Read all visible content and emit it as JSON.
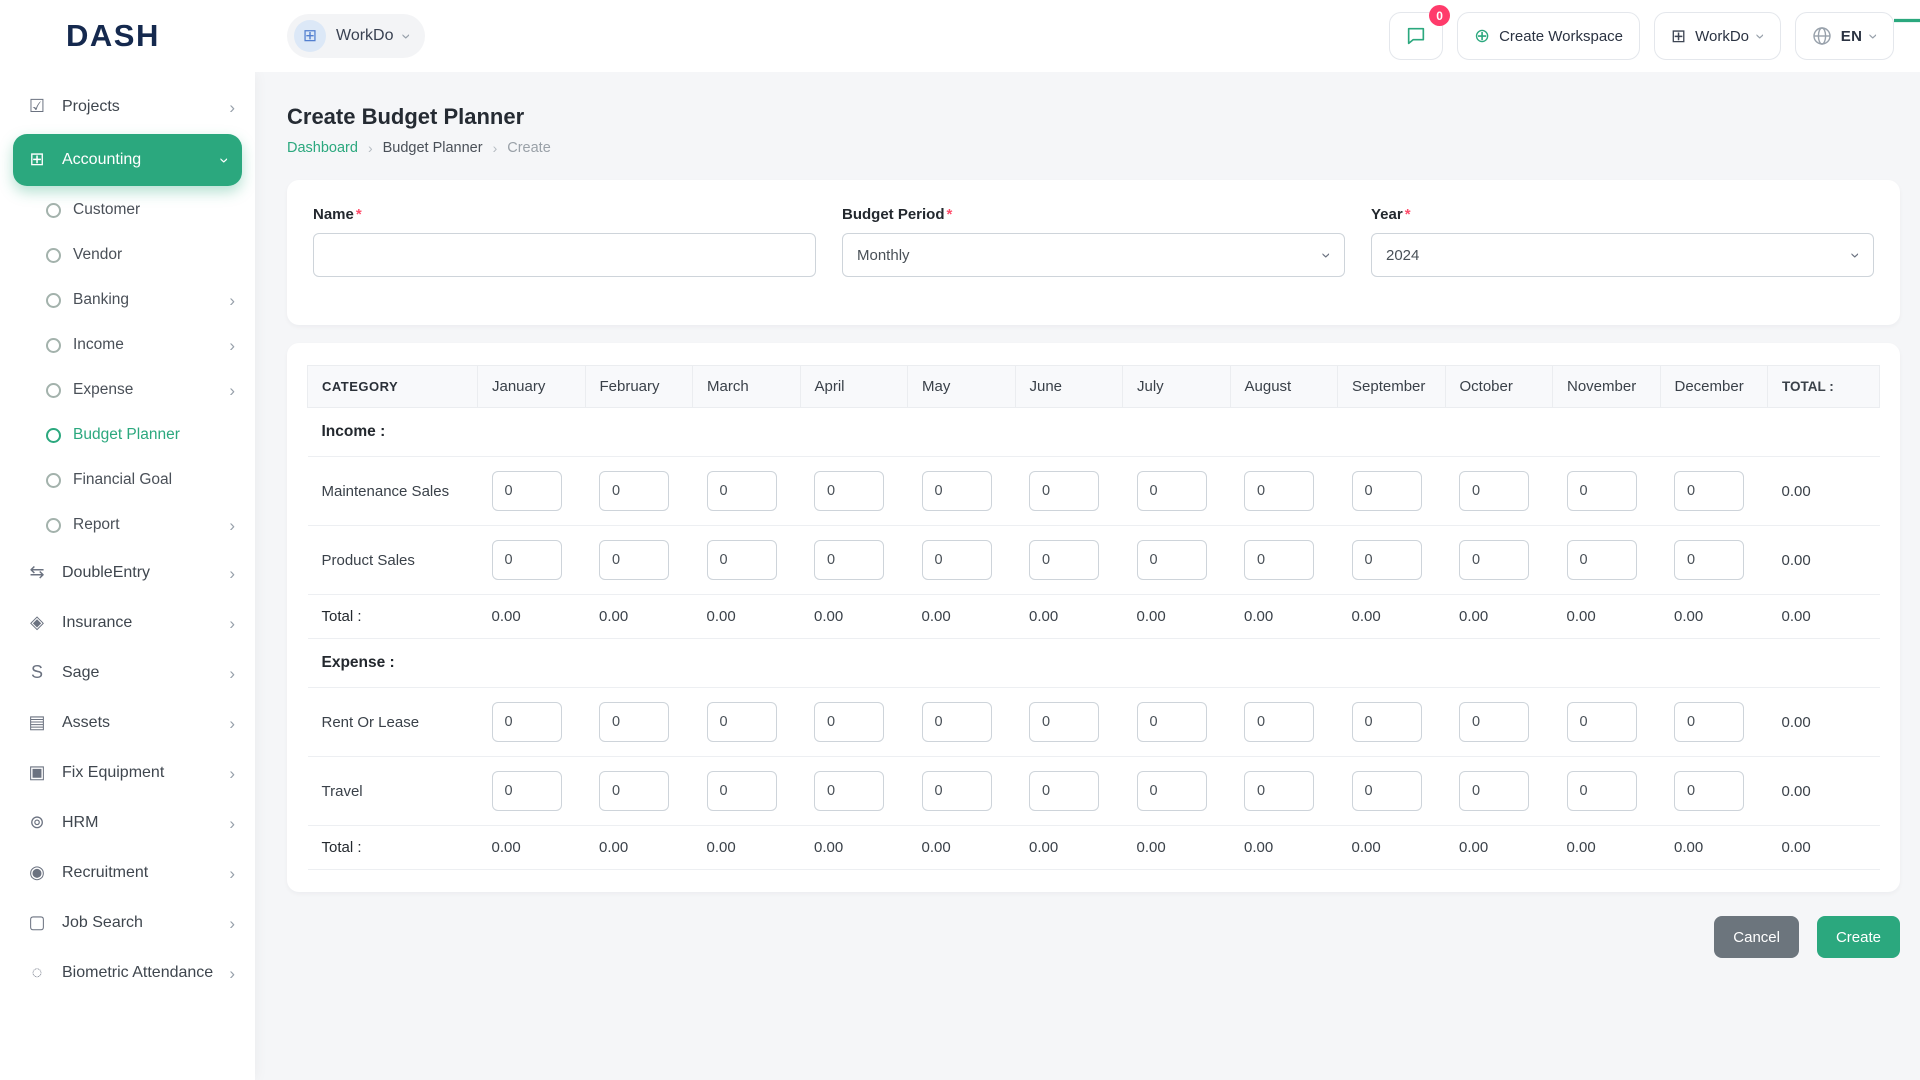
{
  "brand": {
    "name": "DASH"
  },
  "topbar": {
    "workspace_pill": {
      "label": "WorkDo"
    },
    "chat_badge": "0",
    "create_workspace_label": "Create Workspace",
    "workdo_menu_label": "WorkDo",
    "language": "EN"
  },
  "sidebar": {
    "items": [
      {
        "label": "Projects",
        "glyph": "☑",
        "chevron": "right"
      },
      {
        "label": "Accounting",
        "glyph": "⊞",
        "chevron": "down",
        "active": true
      },
      {
        "label": "Customer",
        "sub": true
      },
      {
        "label": "Vendor",
        "sub": true
      },
      {
        "label": "Banking",
        "sub": true,
        "chevron": "right"
      },
      {
        "label": "Income",
        "sub": true,
        "chevron": "right"
      },
      {
        "label": "Expense",
        "sub": true,
        "chevron": "right"
      },
      {
        "label": "Budget Planner",
        "sub": true,
        "active": true
      },
      {
        "label": "Financial Goal",
        "sub": true
      },
      {
        "label": "Report",
        "sub": true,
        "chevron": "right"
      },
      {
        "label": "DoubleEntry",
        "glyph": "⇆",
        "chevron": "right"
      },
      {
        "label": "Insurance",
        "glyph": "◈",
        "chevron": "right"
      },
      {
        "label": "Sage",
        "glyph": "S",
        "chevron": "right"
      },
      {
        "label": "Assets",
        "glyph": "▤",
        "chevron": "right"
      },
      {
        "label": "Fix Equipment",
        "glyph": "▣",
        "chevron": "right"
      },
      {
        "label": "HRM",
        "glyph": "⊚",
        "chevron": "right"
      },
      {
        "label": "Recruitment",
        "glyph": "◉",
        "chevron": "right"
      },
      {
        "label": "Job Search",
        "glyph": "▢",
        "chevron": "right"
      },
      {
        "label": "Biometric Attendance",
        "glyph": "◌",
        "chevron": "right"
      }
    ]
  },
  "page": {
    "title": "Create Budget Planner",
    "breadcrumb": [
      "Dashboard",
      "Budget Planner",
      "Create"
    ]
  },
  "form": {
    "name": {
      "label": "Name",
      "required": "*",
      "value": ""
    },
    "period": {
      "label": "Budget Period",
      "required": "*",
      "value": "Monthly"
    },
    "year": {
      "label": "Year",
      "required": "*",
      "value": "2024"
    }
  },
  "table": {
    "category_header": "CATEGORY",
    "months": [
      "January",
      "February",
      "March",
      "April",
      "May",
      "June",
      "July",
      "August",
      "September",
      "October",
      "November",
      "December"
    ],
    "total_header": "TOTAL :",
    "sections": [
      {
        "title": "Income :",
        "rows": [
          {
            "label": "Maintenance Sales",
            "inputs": [
              "0",
              "0",
              "0",
              "0",
              "0",
              "0",
              "0",
              "0",
              "0",
              "0",
              "0",
              "0"
            ],
            "total": "0.00"
          },
          {
            "label": "Product Sales",
            "inputs": [
              "0",
              "0",
              "0",
              "0",
              "0",
              "0",
              "0",
              "0",
              "0",
              "0",
              "0",
              "0"
            ],
            "total": "0.00"
          }
        ],
        "total_row": {
          "label": "Total :",
          "values": [
            "0.00",
            "0.00",
            "0.00",
            "0.00",
            "0.00",
            "0.00",
            "0.00",
            "0.00",
            "0.00",
            "0.00",
            "0.00",
            "0.00"
          ],
          "total": "0.00"
        }
      },
      {
        "title": "Expense :",
        "rows": [
          {
            "label": "Rent Or Lease",
            "inputs": [
              "0",
              "0",
              "0",
              "0",
              "0",
              "0",
              "0",
              "0",
              "0",
              "0",
              "0",
              "0"
            ],
            "total": "0.00"
          },
          {
            "label": "Travel",
            "inputs": [
              "0",
              "0",
              "0",
              "0",
              "0",
              "0",
              "0",
              "0",
              "0",
              "0",
              "0",
              "0"
            ],
            "total": "0.00"
          }
        ],
        "total_row": {
          "label": "Total :",
          "values": [
            "0.00",
            "0.00",
            "0.00",
            "0.00",
            "0.00",
            "0.00",
            "0.00",
            "0.00",
            "0.00",
            "0.00",
            "0.00",
            "0.00"
          ],
          "total": "0.00"
        }
      }
    ]
  },
  "actions": {
    "cancel": "Cancel",
    "create": "Create"
  },
  "colors": {
    "accent": "#2ba87e",
    "danger": "#ff3b6b",
    "cancel_gray": "#6c757d"
  }
}
